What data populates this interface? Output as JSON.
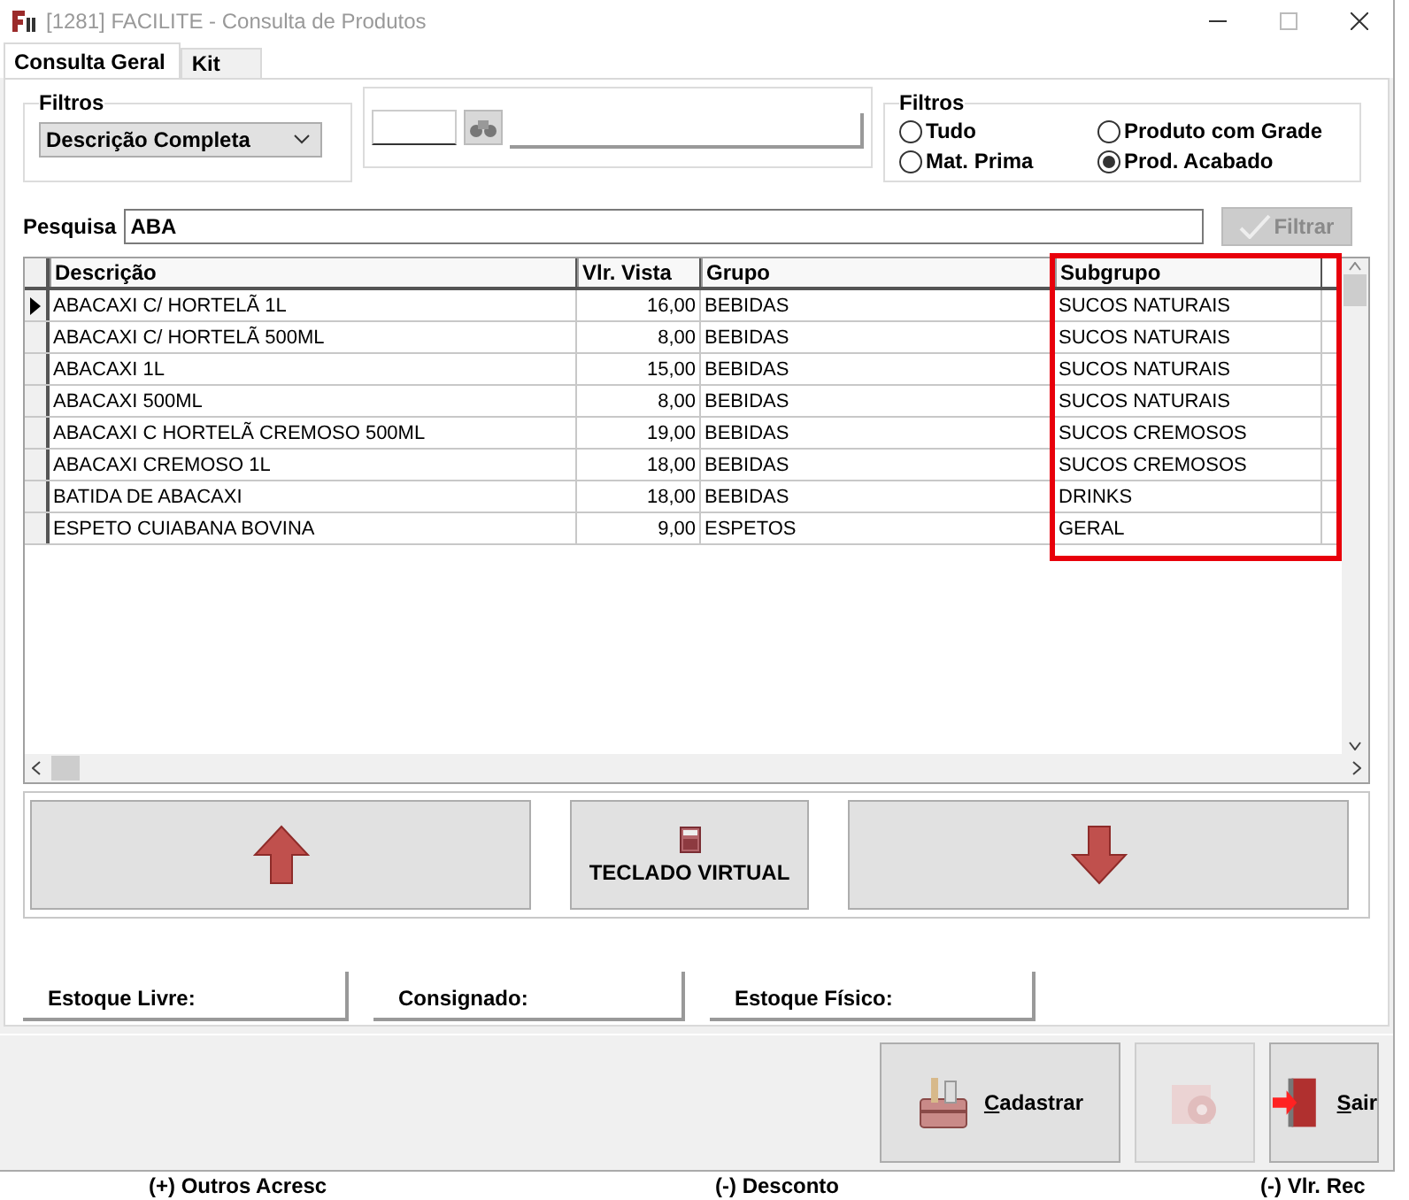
{
  "window": {
    "title": "[1281] FACILITE - Consulta de Produtos"
  },
  "tabs": [
    {
      "label": "Consulta Geral",
      "selected": true
    },
    {
      "label": "Kit",
      "selected": false
    }
  ],
  "filter_left": {
    "legend": "Filtros",
    "value": "Descrição Completa"
  },
  "filter_right": {
    "legend": "Filtros",
    "options": [
      {
        "label": "Tudo",
        "selected": false
      },
      {
        "label": "Produto com Grade",
        "selected": false
      },
      {
        "label": "Mat. Prima",
        "selected": false
      },
      {
        "label": "Prod. Acabado",
        "selected": true
      }
    ]
  },
  "search": {
    "label": "Pesquisa",
    "value": "ABA",
    "button": {
      "label": "Filtrar",
      "disabled": true
    }
  },
  "table": {
    "columns": [
      {
        "label": "Descrição",
        "highlighted": false
      },
      {
        "label": "Vlr. Vista",
        "highlighted": false
      },
      {
        "label": "Grupo",
        "highlighted": false
      },
      {
        "label": "Subgrupo",
        "highlighted": true
      }
    ],
    "rows": [
      {
        "current": true,
        "cells": [
          "ABACAXI  C/ HORTELÃ 1L",
          "16,00",
          "BEBIDAS",
          "SUCOS NATURAIS"
        ]
      },
      {
        "current": false,
        "cells": [
          "ABACAXI  C/ HORTELÃ 500ML",
          "8,00",
          "BEBIDAS",
          "SUCOS NATURAIS"
        ]
      },
      {
        "current": false,
        "cells": [
          "ABACAXI 1L",
          "15,00",
          "BEBIDAS",
          "SUCOS NATURAIS"
        ]
      },
      {
        "current": false,
        "cells": [
          "ABACAXI 500ML",
          "8,00",
          "BEBIDAS",
          "SUCOS NATURAIS"
        ]
      },
      {
        "current": false,
        "cells": [
          "ABACAXI C HORTELÃ CREMOSO 500ML",
          "19,00",
          "BEBIDAS",
          "SUCOS CREMOSOS"
        ]
      },
      {
        "current": false,
        "cells": [
          "ABACAXI CREMOSO 1L",
          "18,00",
          "BEBIDAS",
          "SUCOS CREMOSOS"
        ]
      },
      {
        "current": false,
        "cells": [
          "BATIDA DE ABACAXI",
          "18,00",
          "BEBIDAS",
          "DRINKS"
        ]
      },
      {
        "current": false,
        "cells": [
          "ESPETO CUIABANA BOVINA",
          "9,00",
          "ESPETOS",
          "GERAL"
        ]
      }
    ]
  },
  "keyboard_button": {
    "label": "TECLADO VIRTUAL"
  },
  "stock": [
    "Estoque Livre:",
    "Consignado:",
    "Estoque Físico:"
  ],
  "footer_buttons": [
    {
      "kind": "register",
      "label": "Cadastrar",
      "disabled": false
    },
    {
      "kind": "settings",
      "disabled": true
    },
    {
      "kind": "exit",
      "label": "Sair",
      "disabled": false
    }
  ],
  "background_labels": [
    "(+) Outros Acresc",
    "(-) Desconto",
    "(-) Vlr. Rec"
  ]
}
